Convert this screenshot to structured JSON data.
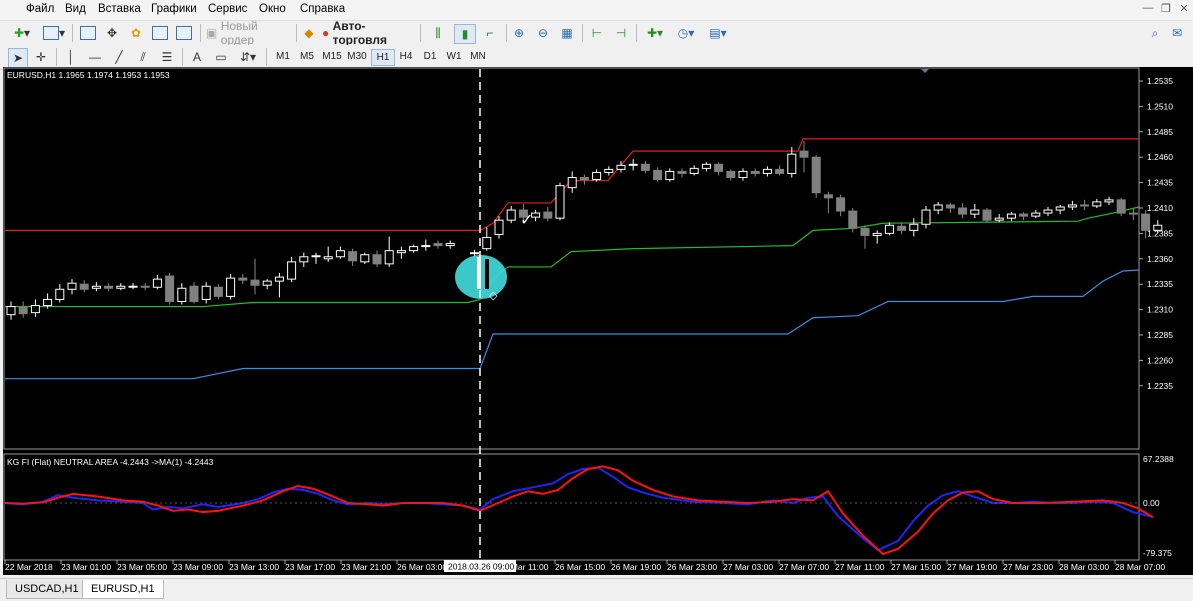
{
  "menu": [
    "Файл",
    "Вид",
    "Вставка",
    "Графики",
    "Сервис",
    "Окно",
    "Справка"
  ],
  "toolbar1": {
    "new_order": "Новый ордер",
    "auto_trading": "Авто-торговля"
  },
  "timeframes": [
    "M1",
    "M5",
    "M15",
    "M30",
    "H1",
    "H4",
    "D1",
    "W1",
    "MN"
  ],
  "active_timeframe": "H1",
  "chart": {
    "symbol_label": "EURUSD,H1  1.1965 1.1974 1.1953 1.1953",
    "indicator_label": "KG FI   (Flat)   NEUTRAL AREA    -4.2443   ->MA(1) -4.2443",
    "cursor_time": "2018.03.26 09:00",
    "price_axis": [
      "1.2535",
      "1.2510",
      "1.2485",
      "1.2460",
      "1.2435",
      "1.2410",
      "1.2385",
      "1.2360",
      "1.2335",
      "1.2310",
      "1.2285",
      "1.2260",
      "1.2235"
    ],
    "indicator_axis": [
      "67.2388",
      "0.00",
      "-79.375"
    ],
    "time_axis": [
      "22 Mar 2018",
      "23 Mar 01:00",
      "23 Mar 05:00",
      "23 Mar 09:00",
      "23 Mar 13:00",
      "23 Mar 17:00",
      "23 Mar 21:00",
      "26 Mar 03:00",
      "26 Mar 11:00",
      "26 Mar 15:00",
      "26 Mar 19:00",
      "26 Mar 23:00",
      "27 Mar 03:00",
      "27 Mar 07:00",
      "27 Mar 11:00",
      "27 Mar 15:00",
      "27 Mar 19:00",
      "27 Mar 23:00",
      "28 Mar 03:00",
      "28 Mar 07:00"
    ],
    "colors": {
      "background": "#000000",
      "red_line": "#e02020",
      "green_line": "#20c020",
      "blue_line": "#3a8ee6",
      "bull_candle": "#ffffff",
      "bear_candle": "#808080",
      "fi_blue": "#2222ff",
      "fi_red": "#ff1111",
      "highlight": "#3fd3d3"
    }
  },
  "tabs": [
    "USDCAD,H1",
    "EURUSD,H1"
  ],
  "active_tab": "EURUSD,H1"
}
